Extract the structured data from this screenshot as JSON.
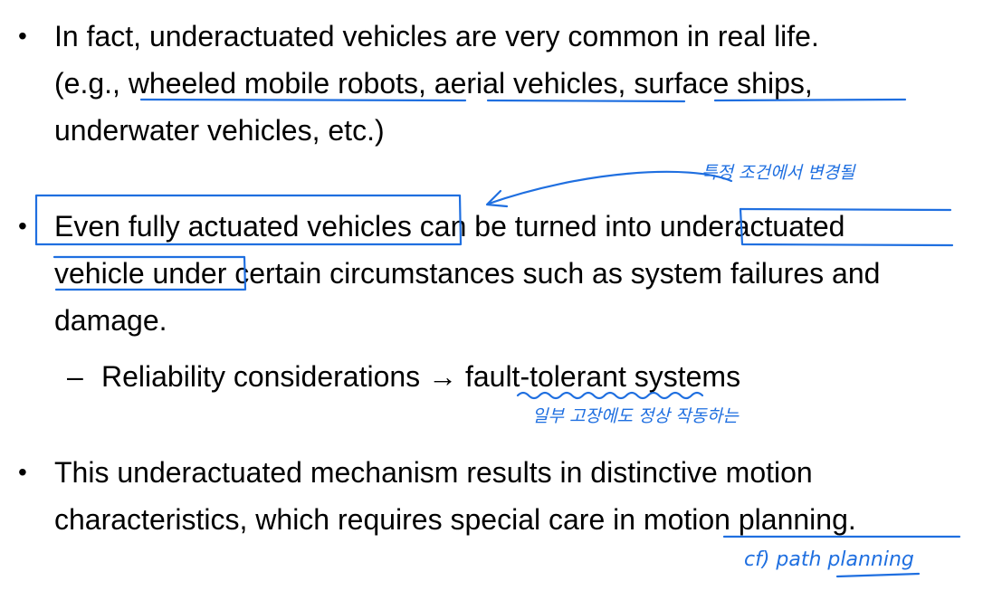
{
  "slide": {
    "bullet_glyph": "•",
    "dash_glyph": "–",
    "b1_l1": "In fact, underactuated vehicles are very common in real life.",
    "b1_l2_a": "(e.g., ",
    "b1_l2_u1": "wheeled mobile robots",
    "b1_l2_b": ", ",
    "b1_l2_u2": "aerial vehicles",
    "b1_l2_c": ", ",
    "b1_l2_u3": "surface ships",
    "b1_l2_d": ",",
    "b1_l3": "underwater vehicles, etc.)",
    "b2_l1_a": "Even fully actuated vehicles",
    "b2_l1_b": " can be turned into ",
    "b2_l1_c": "underactuated",
    "b2_l2_a": "vehicle under",
    "b2_l2_b": " certain circumstances such as system failures and",
    "b2_l3": "damage.",
    "sub_a": "Reliability considerations ",
    "sub_arrow": "→",
    "sub_b": " ",
    "sub_u": "fault-tolerant",
    "sub_c": " systems",
    "b3_l1": "This underactuated mechanism results in distinctive motion",
    "b3_l2_a": "characteristics, which requires special care in ",
    "b3_l2_u": "motion planning",
    "b3_l2_b": "."
  },
  "annotations": {
    "ink_color": "#1f6fe0",
    "note_top": "특정 조건에서 변경될",
    "note_fault": "일부 고장에도 정상 작동하는",
    "note_cf": "cf) path planning"
  }
}
